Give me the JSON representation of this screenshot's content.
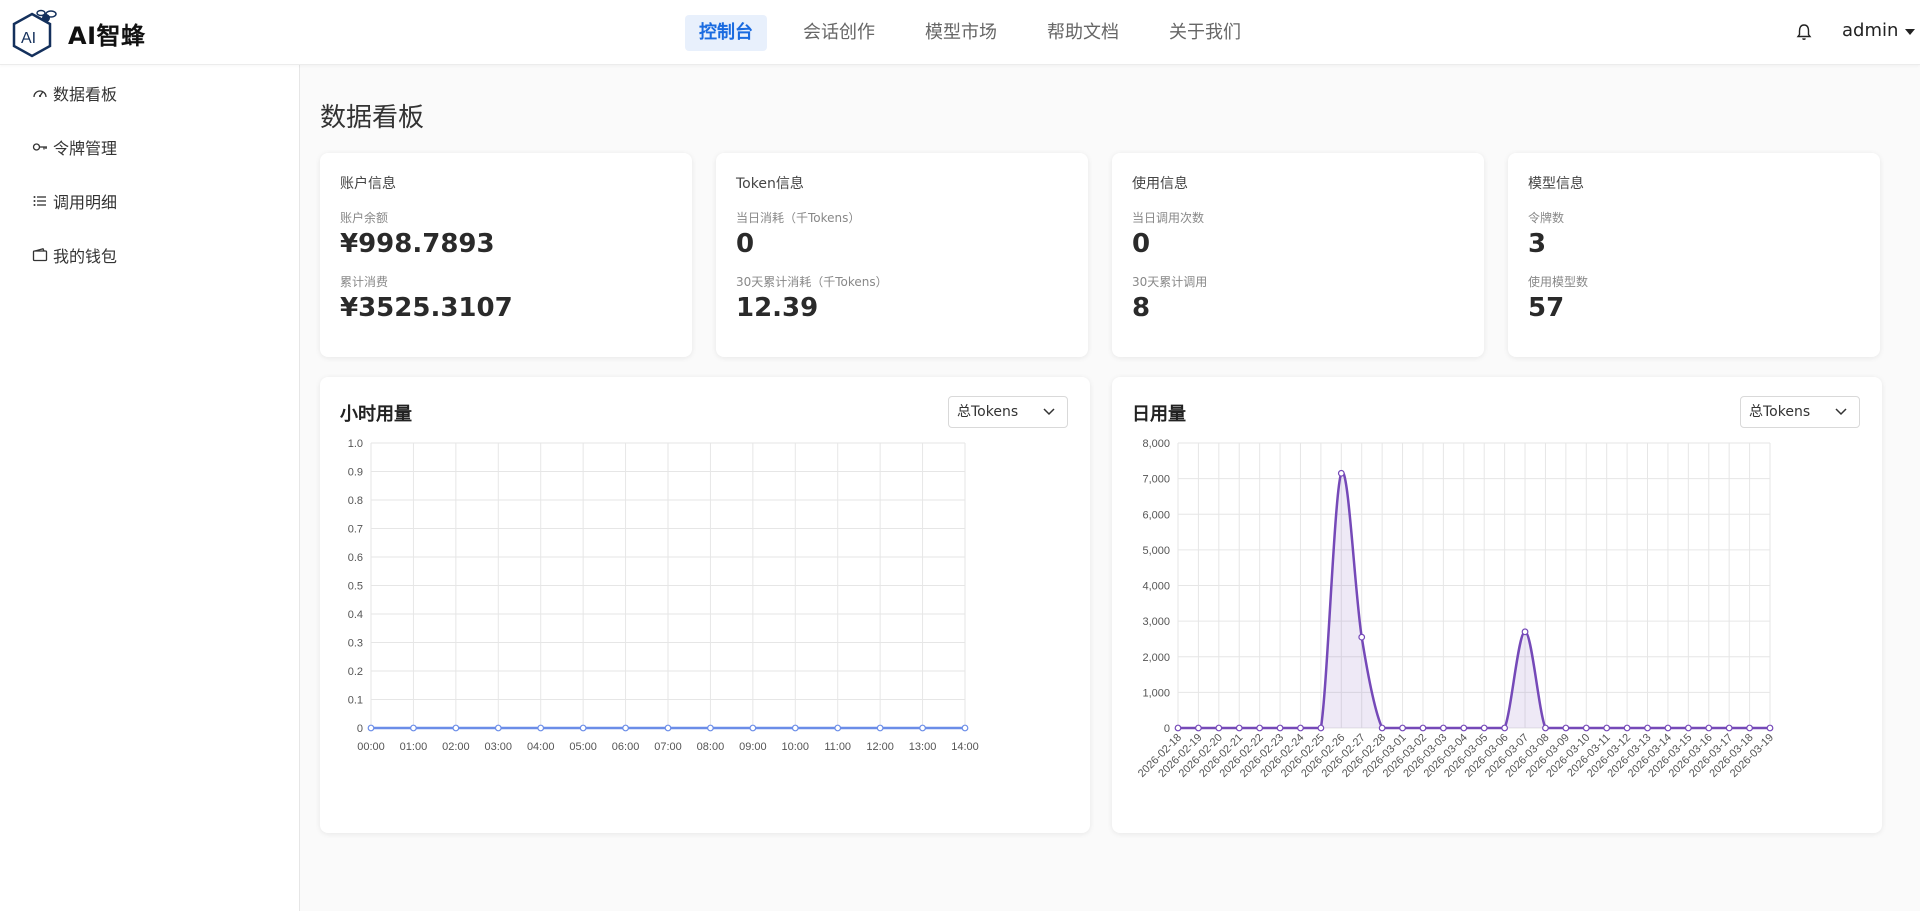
{
  "app": {
    "name": "AI智蜂"
  },
  "nav": {
    "items": [
      {
        "label": "控制台",
        "active": true
      },
      {
        "label": "会话创作"
      },
      {
        "label": "模型市场"
      },
      {
        "label": "帮助文档"
      },
      {
        "label": "关于我们"
      }
    ]
  },
  "header": {
    "user": "admin"
  },
  "sidebar": {
    "items": [
      {
        "label": "数据看板",
        "icon": "dashboard-icon"
      },
      {
        "label": "令牌管理",
        "icon": "key-icon"
      },
      {
        "label": "调用明细",
        "icon": "list-icon"
      },
      {
        "label": "我的钱包",
        "icon": "wallet-icon"
      }
    ]
  },
  "page": {
    "title": "数据看板"
  },
  "cards": [
    {
      "title": "账户信息",
      "label1": "账户余额",
      "value1": "¥998.7893",
      "label2": "累计消费",
      "value2": "¥3525.3107"
    },
    {
      "title": "Token信息",
      "label1": "当日消耗（千Tokens）",
      "value1": "0",
      "label2": "30天累计消耗（千Tokens）",
      "value2": "12.39"
    },
    {
      "title": "使用信息",
      "label1": "当日调用次数",
      "value1": "0",
      "label2": "30天累计调用",
      "value2": "8"
    },
    {
      "title": "模型信息",
      "label1": "令牌数",
      "value1": "3",
      "label2": "使用模型数",
      "value2": "57"
    }
  ],
  "charts": {
    "hourly": {
      "title": "小时用量",
      "select": "总Tokens"
    },
    "daily": {
      "title": "日用量",
      "select": "总Tokens"
    }
  },
  "colors": {
    "accent": "#1a6be0",
    "hourly_line": "#6b8de8",
    "daily_line": "#7549b8"
  },
  "chart_data": [
    {
      "type": "line",
      "title": "小时用量",
      "x": [
        "00:00",
        "01:00",
        "02:00",
        "03:00",
        "04:00",
        "05:00",
        "06:00",
        "07:00",
        "08:00",
        "09:00",
        "10:00",
        "11:00",
        "12:00",
        "13:00",
        "14:00"
      ],
      "y_ticks": [
        "0",
        "0.1",
        "0.2",
        "0.3",
        "0.4",
        "0.5",
        "0.6",
        "0.7",
        "0.8",
        "0.9",
        "1.0"
      ],
      "values": [
        0,
        0,
        0,
        0,
        0,
        0,
        0,
        0,
        0,
        0,
        0,
        0,
        0,
        0,
        0
      ],
      "ylim": [
        0,
        1
      ],
      "grid": true
    },
    {
      "type": "area",
      "title": "日用量",
      "x": [
        "2026-02-18",
        "2026-02-19",
        "2026-02-20",
        "2026-02-21",
        "2026-02-22",
        "2026-02-23",
        "2026-02-24",
        "2026-02-25",
        "2026-02-26",
        "2026-02-27",
        "2026-02-28",
        "2026-03-01",
        "2026-03-02",
        "2026-03-03",
        "2026-03-04",
        "2026-03-05",
        "2026-03-06",
        "2026-03-07",
        "2026-03-08",
        "2026-03-09",
        "2026-03-10",
        "2026-03-11",
        "2026-03-12",
        "2026-03-13",
        "2026-03-14",
        "2026-03-15",
        "2026-03-16",
        "2026-03-17",
        "2026-03-18",
        "2026-03-19"
      ],
      "y_ticks": [
        "0",
        "1,000",
        "2,000",
        "3,000",
        "4,000",
        "5,000",
        "6,000",
        "7,000",
        "8,000"
      ],
      "values": [
        0,
        0,
        0,
        0,
        0,
        0,
        0,
        0,
        7150,
        2550,
        0,
        0,
        0,
        0,
        0,
        0,
        0,
        2700,
        0,
        0,
        0,
        0,
        0,
        0,
        0,
        0,
        0,
        0,
        0,
        0
      ],
      "ylim": [
        0,
        8000
      ],
      "grid": true
    }
  ]
}
